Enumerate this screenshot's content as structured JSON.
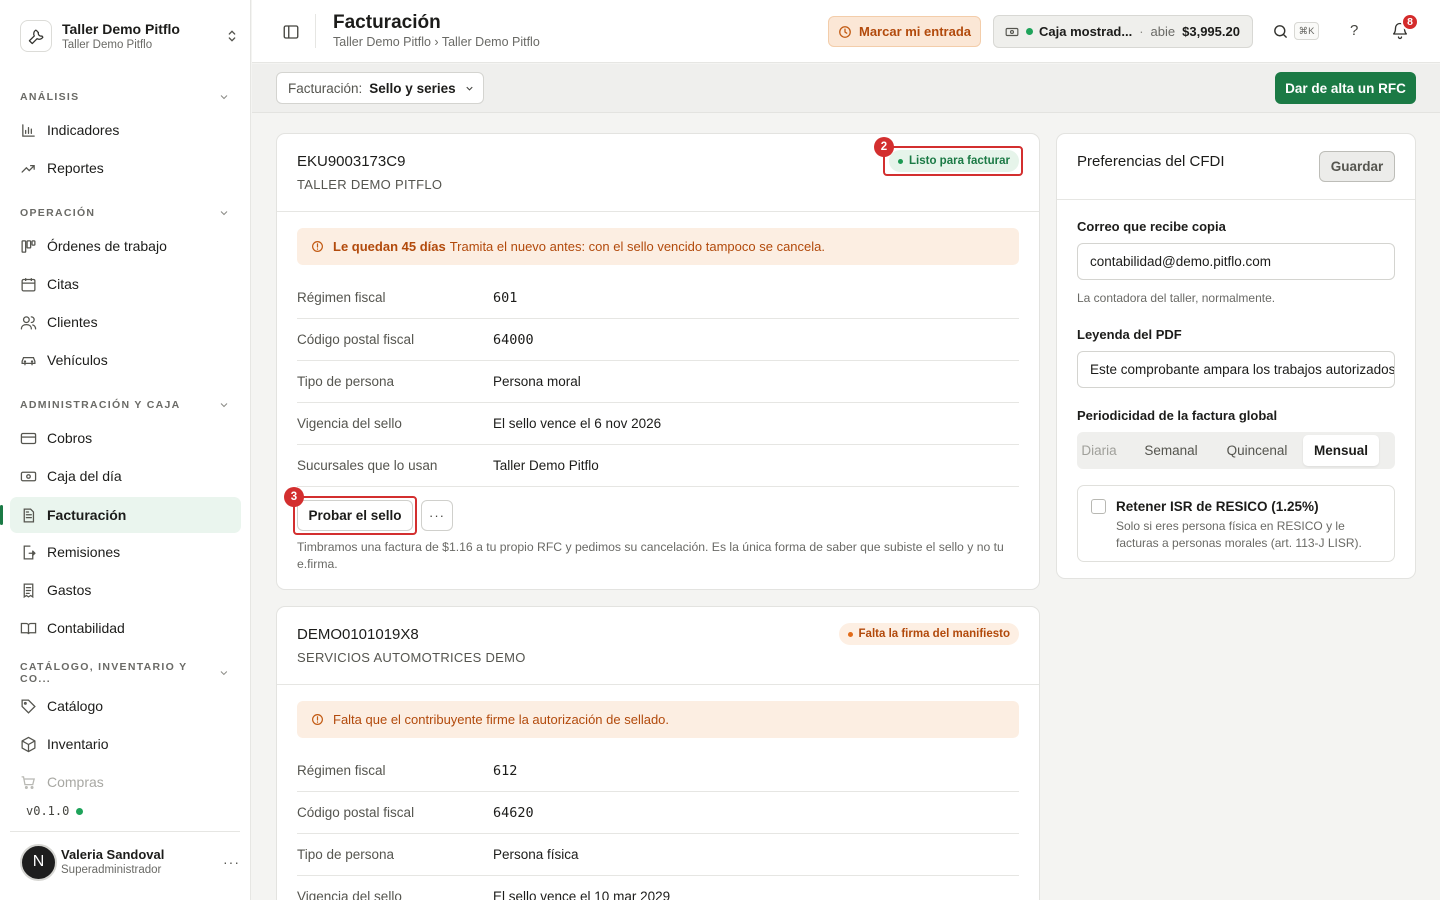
{
  "brand": {
    "name": "Taller Demo Pitflo",
    "sub": "Taller Demo Pitflo"
  },
  "sidebar": {
    "sections": [
      {
        "title": "ANÁLISIS"
      },
      {
        "title": "OPERACIÓN"
      },
      {
        "title": "ADMINISTRACIÓN Y CAJA"
      },
      {
        "title": "CATÁLOGO, INVENTARIO Y CO..."
      }
    ],
    "items": [
      {
        "label": "Indicadores"
      },
      {
        "label": "Reportes"
      },
      {
        "label": "Órdenes de trabajo"
      },
      {
        "label": "Citas"
      },
      {
        "label": "Clientes"
      },
      {
        "label": "Vehículos"
      },
      {
        "label": "Cobros"
      },
      {
        "label": "Caja del día"
      },
      {
        "label": "Facturación"
      },
      {
        "label": "Remisiones"
      },
      {
        "label": "Gastos"
      },
      {
        "label": "Contabilidad"
      },
      {
        "label": "Catálogo"
      },
      {
        "label": "Inventario"
      },
      {
        "label": "Compras"
      }
    ],
    "version": "v0.1.0"
  },
  "user": {
    "initial": "N",
    "name": "Valeria Sandoval",
    "role": "Superadministrador"
  },
  "topbar": {
    "title": "Facturación",
    "breadcrumb": "Taller Demo Pitflo › Taller Demo Pitflo",
    "entrada_label": "Marcar mi entrada",
    "caja": {
      "name": "Caja mostrad...",
      "sep": "·",
      "status": "abie",
      "amount": "$3,995.20"
    },
    "kbd": "⌘K",
    "help": "?",
    "notifications": "8"
  },
  "subbar": {
    "select_label": "Facturación:",
    "select_value": "Sello y series",
    "rfc_button": "Dar de alta un RFC"
  },
  "cards": [
    {
      "rfc": "EKU9003173C9",
      "name": "TALLER DEMO PITFLO",
      "status": "Listo para facturar",
      "alert_bold": "Le quedan 45 días",
      "alert_text": "Tramita el nuevo antes: con el sello vencido tampoco se cancela.",
      "rows": [
        {
          "k": "Régimen fiscal",
          "v": "601"
        },
        {
          "k": "Código postal fiscal",
          "v": "64000"
        },
        {
          "k": "Tipo de persona",
          "v": "Persona moral"
        },
        {
          "k": "Vigencia del sello",
          "v": "El sello vence el 6 nov 2026"
        },
        {
          "k": "Sucursales que lo usan",
          "v": "Taller Demo Pitflo"
        }
      ],
      "probar_label": "Probar el sello",
      "more_label": "···",
      "hint": "Timbramos una factura de $1.16 a tu propio RFC y pedimos su cancelación. Es la única forma de saber que subiste el sello y no tu e.firma."
    },
    {
      "rfc": "DEMO0101019X8",
      "name": "SERVICIOS AUTOMOTRICES DEMO",
      "status": "Falta la firma del manifiesto",
      "alert_text": "Falta que el contribuyente firme la autorización de sellado.",
      "rows": [
        {
          "k": "Régimen fiscal",
          "v": "612"
        },
        {
          "k": "Código postal fiscal",
          "v": "64620"
        },
        {
          "k": "Tipo de persona",
          "v": "Persona física"
        },
        {
          "k": "Vigencia del sello",
          "v": "El sello vence el 10 mar 2029"
        }
      ]
    }
  ],
  "annotations": {
    "n2": "2",
    "n3": "3"
  },
  "prefs": {
    "title": "Preferencias del CFDI",
    "save": "Guardar",
    "email_label": "Correo que recibe copia",
    "email_value": "contabilidad@demo.pitflo.com",
    "email_help": "La contadora del taller, normalmente.",
    "legend_label": "Leyenda del PDF",
    "legend_value": "Este comprobante ampara los trabajos autorizados",
    "period_label": "Periodicidad de la factura global",
    "periods": [
      "Diaria",
      "Semanal",
      "Quincenal",
      "Mensual"
    ],
    "period_selected": "Mensual",
    "resico_title": "Retener ISR de RESICO (1.25%)",
    "resico_desc": "Solo si eres persona física en RESICO y le facturas a personas morales (art. 113-J LISR).",
    "resico_checked": false
  },
  "colors": {
    "accent": "#1b7a45",
    "warning": "#b24a0c",
    "highlight": "#d32f2f"
  }
}
